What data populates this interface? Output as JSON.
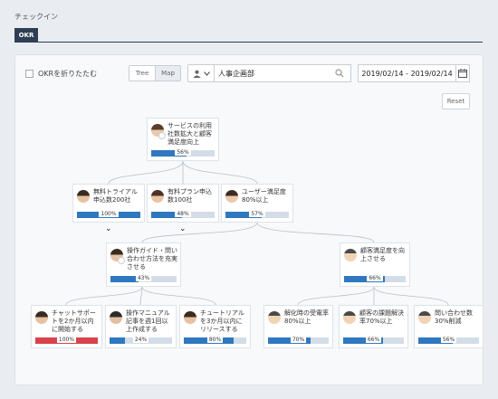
{
  "header": {
    "page_label": "チェックイン",
    "tab_label": "OKR"
  },
  "toolbar": {
    "collapse_label": "OKRを折りたたむ",
    "view_tree": "Tree",
    "view_map": "Map",
    "department": "人事企画部",
    "date_from": "2019/02/14",
    "date_sep": "-",
    "date_to": "2019/02/14",
    "reset": "Reset"
  },
  "tree": {
    "root": {
      "title": "サービスの利用社数拡大と顧客満足度向上",
      "progress": 56,
      "label": "56%"
    },
    "level1": [
      {
        "title": "無料トライアル申込数200社",
        "progress": 100,
        "label": "100%"
      },
      {
        "title": "有料プラン申込数100社",
        "progress": 48,
        "label": "48%"
      },
      {
        "title": "ユーザー満足度80%以上",
        "progress": 57,
        "label": "57%"
      }
    ],
    "level2": [
      {
        "title": "操作ガイド・問い合わせ方法を充実させる",
        "progress": 43,
        "label": "43%"
      },
      {
        "title": "顧客満足度を向上させる",
        "progress": 66,
        "label": "66%"
      }
    ],
    "level3": [
      {
        "title": "チャットサポートを2か月以内に開始する",
        "progress": 100,
        "label": "100%",
        "status": "red"
      },
      {
        "title": "操作マニュアル記事を週1回以上作成する",
        "progress": 24,
        "label": "24%"
      },
      {
        "title": "チュートリアルを3か月以内にリリースする",
        "progress": 80,
        "label": "80%"
      },
      {
        "title": "解化時の受電率80%以上",
        "progress": 70,
        "label": "70%"
      },
      {
        "title": "顧客の課題解決率70%以上",
        "progress": 66,
        "label": "66%"
      },
      {
        "title": "問い合わせ数30%削減",
        "progress": 56,
        "label": "56%"
      }
    ]
  },
  "colors": {
    "accent": "#2f78bf",
    "danger": "#d9434b",
    "tab": "#2e3f55"
  }
}
